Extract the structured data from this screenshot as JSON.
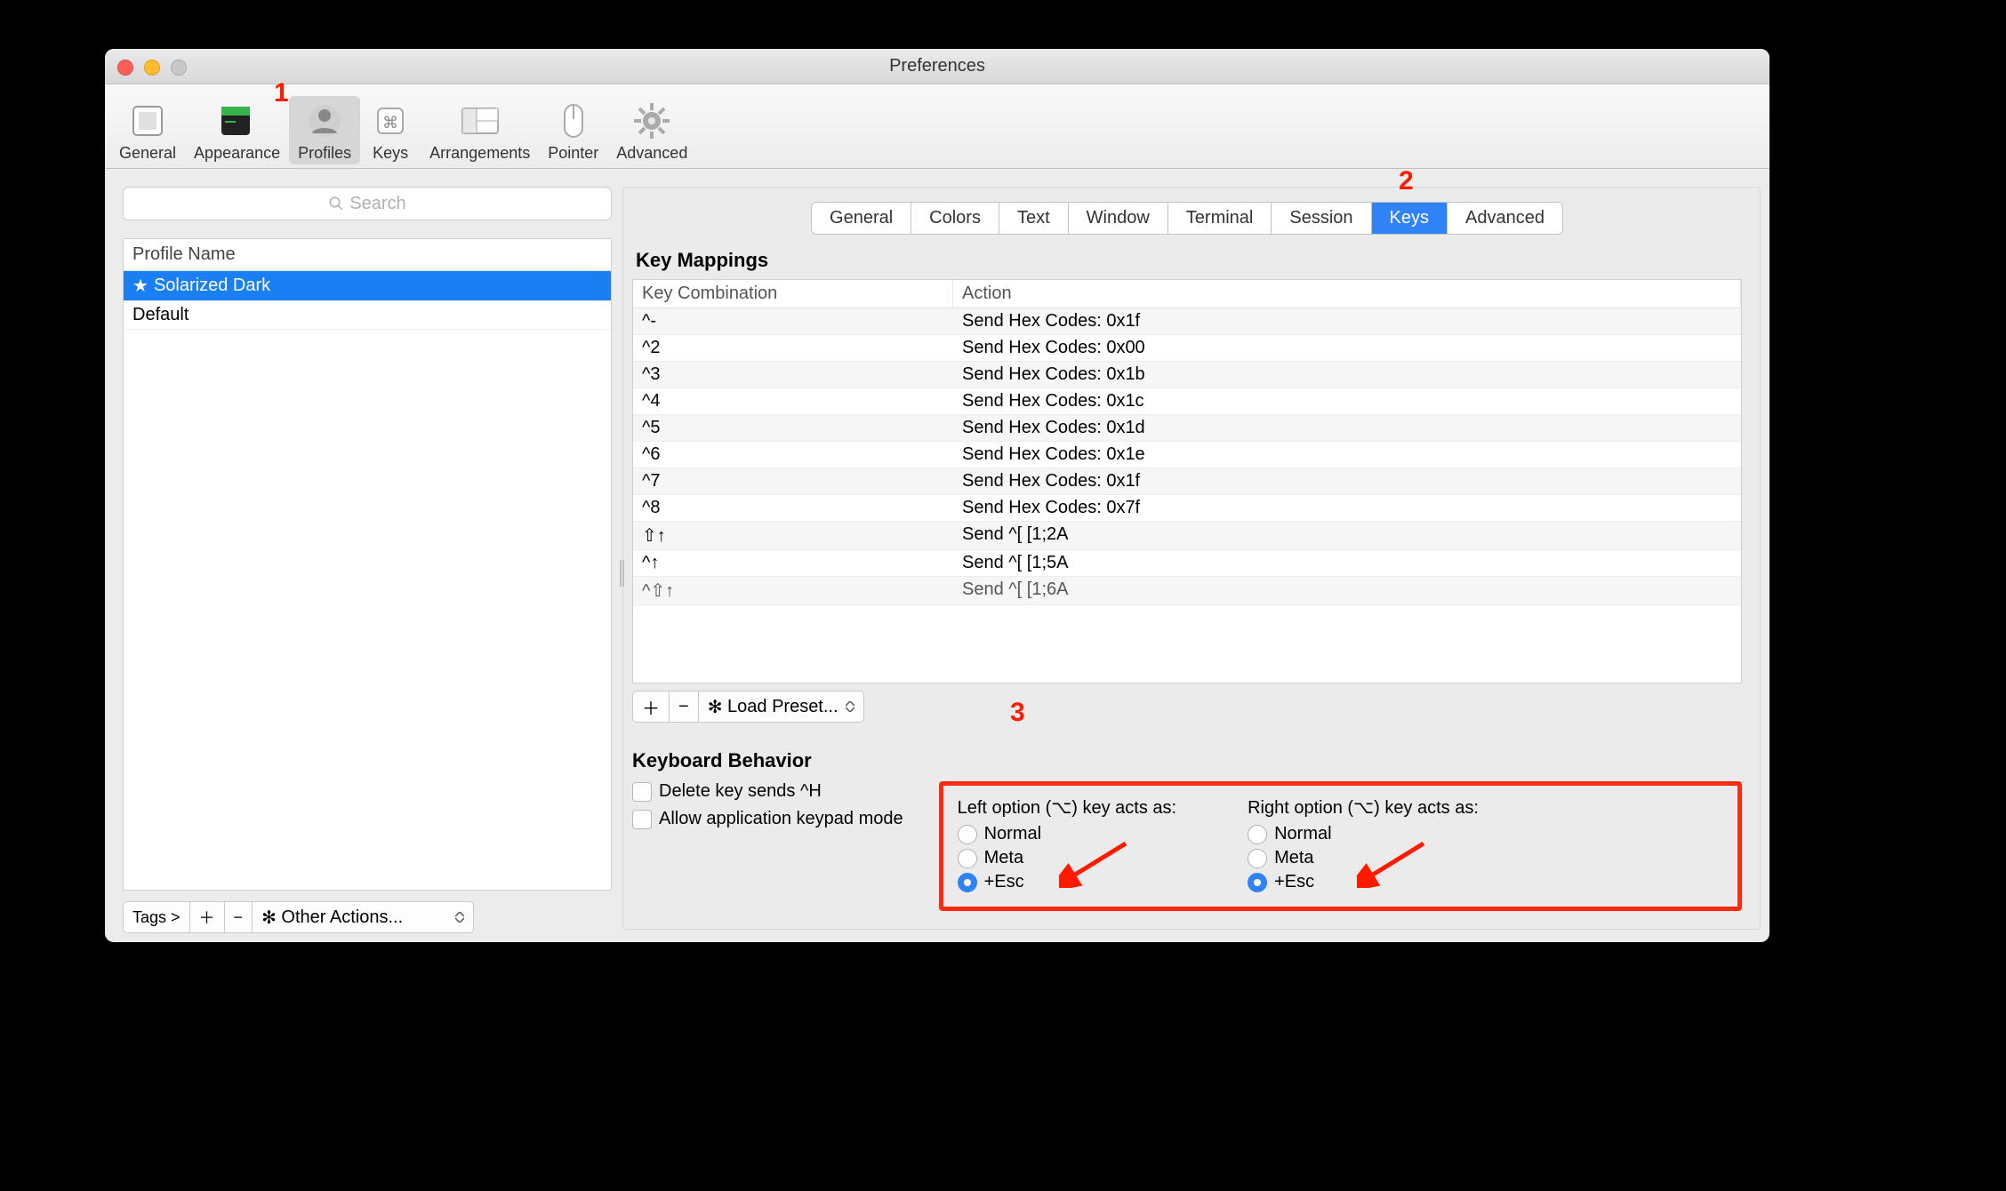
{
  "window": {
    "title": "Preferences"
  },
  "toolbar": [
    {
      "label": "General",
      "icon": "general"
    },
    {
      "label": "Appearance",
      "icon": "appearance"
    },
    {
      "label": "Profiles",
      "icon": "profiles",
      "selected": true
    },
    {
      "label": "Keys",
      "icon": "keys"
    },
    {
      "label": "Arrangements",
      "icon": "arrangements"
    },
    {
      "label": "Pointer",
      "icon": "pointer"
    },
    {
      "label": "Advanced",
      "icon": "advanced"
    }
  ],
  "search": {
    "placeholder": "Search"
  },
  "profile_list": {
    "header": "Profile Name",
    "items": [
      {
        "label": "Solarized Dark",
        "starred": true,
        "selected": true
      },
      {
        "label": "Default"
      }
    ],
    "tags_button": "Tags >",
    "other_actions": "Other Actions..."
  },
  "subtabs": [
    "General",
    "Colors",
    "Text",
    "Window",
    "Terminal",
    "Session",
    "Keys",
    "Advanced"
  ],
  "active_subtab": "Keys",
  "key_mappings": {
    "title": "Key Mappings",
    "columns": [
      "Key Combination",
      "Action"
    ],
    "rows": [
      {
        "combo": "^-",
        "action": "Send Hex Codes: 0x1f"
      },
      {
        "combo": "^2",
        "action": "Send Hex Codes: 0x00"
      },
      {
        "combo": "^3",
        "action": "Send Hex Codes: 0x1b"
      },
      {
        "combo": "^4",
        "action": "Send Hex Codes: 0x1c"
      },
      {
        "combo": "^5",
        "action": "Send Hex Codes: 0x1d"
      },
      {
        "combo": "^6",
        "action": "Send Hex Codes: 0x1e"
      },
      {
        "combo": "^7",
        "action": "Send Hex Codes: 0x1f"
      },
      {
        "combo": "^8",
        "action": "Send Hex Codes: 0x7f"
      },
      {
        "combo": "⇧↑",
        "action": "Send ^[ [1;2A"
      },
      {
        "combo": "^↑",
        "action": "Send ^[ [1;5A"
      },
      {
        "combo": "^⇧↑",
        "action": "Send ^[ [1;6A"
      }
    ],
    "load_preset": "Load Preset..."
  },
  "keyboard_behavior": {
    "title": "Keyboard Behavior",
    "delete_sends": "Delete key sends ^H",
    "allow_keypad": "Allow application keypad mode",
    "left_option": {
      "label": "Left option (⌥) key acts as:",
      "options": [
        "Normal",
        "Meta",
        "+Esc"
      ],
      "selected": "+Esc"
    },
    "right_option": {
      "label": "Right option (⌥) key acts as:",
      "options": [
        "Normal",
        "Meta",
        "+Esc"
      ],
      "selected": "+Esc"
    }
  },
  "callouts": {
    "one": "1",
    "two": "2",
    "three": "3"
  }
}
